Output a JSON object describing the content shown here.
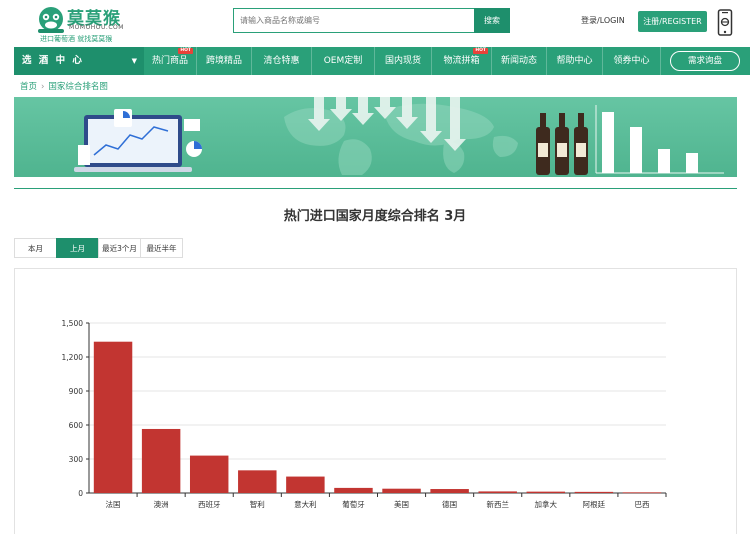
{
  "header": {
    "logo_title": "莫莫猴",
    "logo_en": "MOMOHOU.COM",
    "logo_slogan": "进口葡萄酒 就找莫莫猴",
    "search_placeholder": "请输入商品名称或编号",
    "search_button": "搜索",
    "login": "登录/LOGIN",
    "register": "注册/REGISTER"
  },
  "nav": {
    "category": "选 酒 中 心",
    "items": [
      {
        "label": "热门商品",
        "hot": "HOT"
      },
      {
        "label": "跨境精品",
        "hot": ""
      },
      {
        "label": "清仓特惠",
        "hot": ""
      },
      {
        "label": "OEM定制",
        "hot": ""
      },
      {
        "label": "国内现货",
        "hot": ""
      },
      {
        "label": "物流拼箱",
        "hot": "HOT"
      },
      {
        "label": "新闻动态",
        "hot": ""
      },
      {
        "label": "帮助中心",
        "hot": ""
      },
      {
        "label": "领券中心",
        "hot": ""
      }
    ],
    "demand_button": "需求询盘"
  },
  "breadcrumb": {
    "home": "首页",
    "current": "国家综合排名图"
  },
  "page_title": "热门进口国家月度综合排名 3月",
  "tabs": [
    {
      "label": "本月",
      "active": false
    },
    {
      "label": "上月",
      "active": true
    },
    {
      "label": "最近3个月",
      "active": false
    },
    {
      "label": "最近半年",
      "active": false
    }
  ],
  "colors": {
    "brand": "#2aa079",
    "brand_dark": "#1e8f6c",
    "bar": "#c23531",
    "hot": "#e8433a"
  },
  "chart_data": {
    "type": "bar",
    "title": "",
    "xlabel": "",
    "ylabel": "",
    "categories": [
      "法国",
      "澳洲",
      "西班牙",
      "智利",
      "意大利",
      "葡萄牙",
      "美国",
      "德国",
      "新西兰",
      "加拿大",
      "阿根廷",
      "巴西"
    ],
    "values": [
      1335,
      565,
      330,
      200,
      145,
      45,
      38,
      35,
      14,
      12,
      10,
      6
    ],
    "ylim": [
      0,
      1500
    ],
    "yticks": [
      0,
      300,
      600,
      900,
      1200,
      1500
    ],
    "ytick_labels": [
      "0",
      "300",
      "600",
      "900",
      "1,200",
      "1,500"
    ],
    "grid": true,
    "color": "#c23531"
  }
}
